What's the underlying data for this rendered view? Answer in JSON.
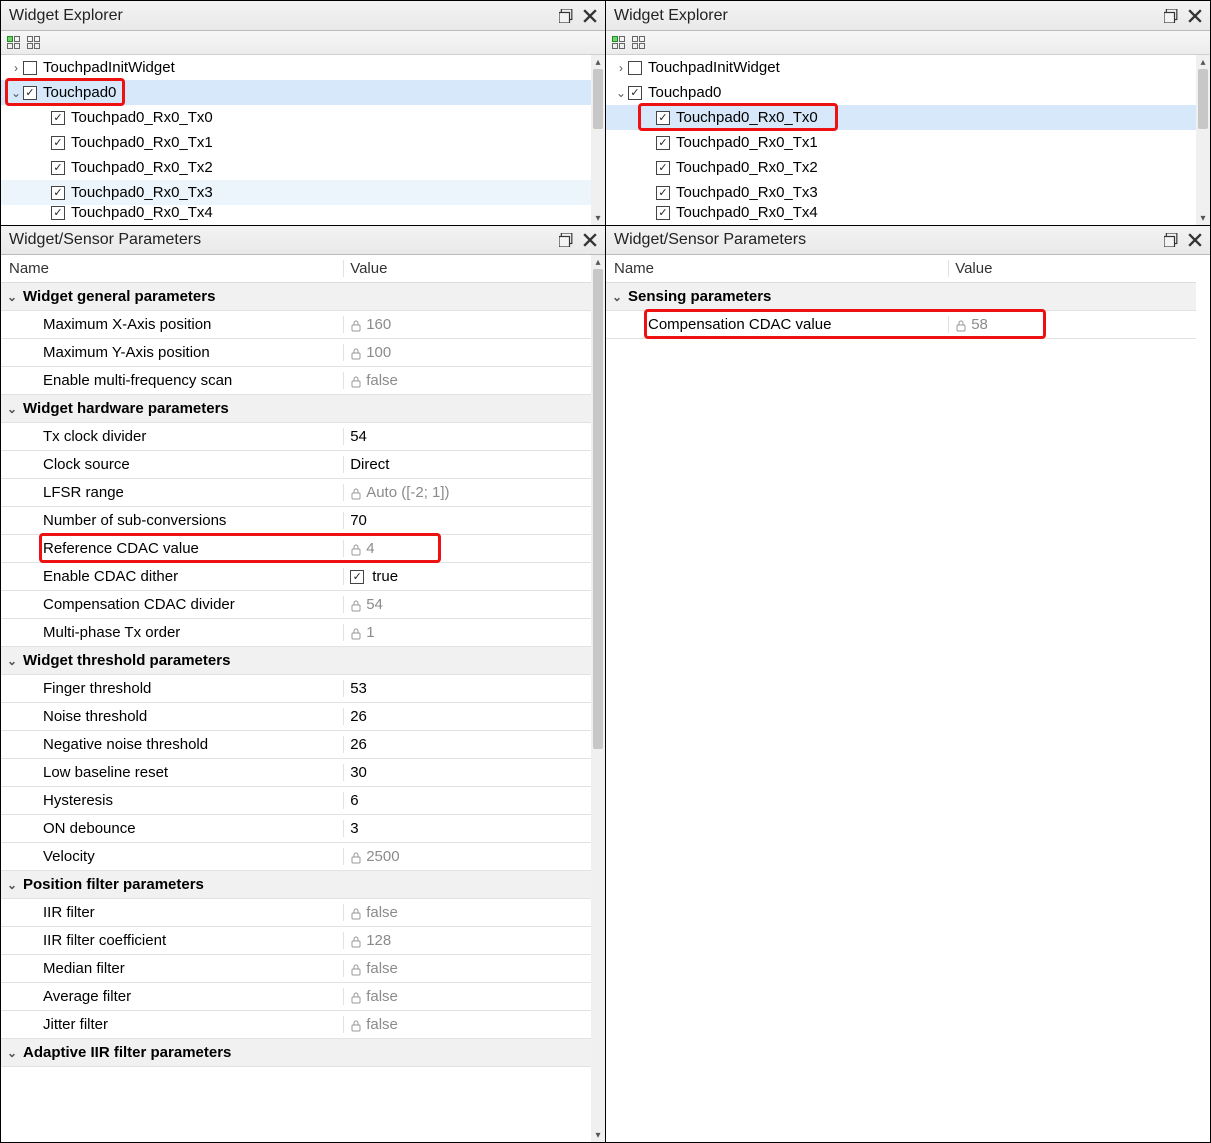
{
  "left": {
    "explorer": {
      "title": "Widget Explorer",
      "items": [
        {
          "level": 0,
          "expanded": false,
          "checked": false,
          "label": "TouchpadInitWidget",
          "selected": false
        },
        {
          "level": 0,
          "expanded": true,
          "checked": true,
          "label": "Touchpad0",
          "selected": true,
          "highlight": true
        },
        {
          "level": 1,
          "checked": true,
          "label": "Touchpad0_Rx0_Tx0"
        },
        {
          "level": 1,
          "checked": true,
          "label": "Touchpad0_Rx0_Tx1"
        },
        {
          "level": 1,
          "checked": true,
          "label": "Touchpad0_Rx0_Tx2"
        },
        {
          "level": 1,
          "checked": true,
          "label": "Touchpad0_Rx0_Tx3",
          "hover": true
        }
      ]
    },
    "params": {
      "title": "Widget/Sensor Parameters",
      "name_header": "Name",
      "value_header": "Value",
      "groups": [
        {
          "label": "Widget general parameters",
          "rows": [
            {
              "name": "Maximum X-Axis position",
              "value": "160",
              "locked": true
            },
            {
              "name": "Maximum Y-Axis position",
              "value": "100",
              "locked": true
            },
            {
              "name": "Enable multi-frequency scan",
              "value": "false",
              "locked": true
            }
          ]
        },
        {
          "label": "Widget hardware parameters",
          "rows": [
            {
              "name": "Tx clock divider",
              "value": "54"
            },
            {
              "name": "Clock source",
              "value": "Direct"
            },
            {
              "name": "LFSR range",
              "value": "Auto ([-2; 1])",
              "locked": true
            },
            {
              "name": "Number of sub-conversions",
              "value": "70"
            },
            {
              "name": "Reference CDAC value",
              "value": "4",
              "locked": true,
              "highlight": true
            },
            {
              "name": "Enable CDAC dither",
              "value": "true",
              "checkbox": true
            },
            {
              "name": "Compensation CDAC divider",
              "value": "54",
              "locked": true
            },
            {
              "name": "Multi-phase Tx order",
              "value": "1",
              "locked": true
            }
          ]
        },
        {
          "label": "Widget threshold parameters",
          "rows": [
            {
              "name": "Finger threshold",
              "value": "53"
            },
            {
              "name": "Noise threshold",
              "value": "26"
            },
            {
              "name": "Negative noise threshold",
              "value": "26"
            },
            {
              "name": "Low baseline reset",
              "value": "30"
            },
            {
              "name": "Hysteresis",
              "value": "6"
            },
            {
              "name": "ON debounce",
              "value": "3"
            },
            {
              "name": "Velocity",
              "value": "2500",
              "locked": true
            }
          ]
        },
        {
          "label": "Position filter parameters",
          "rows": [
            {
              "name": "IIR filter",
              "value": "false",
              "locked": true
            },
            {
              "name": "IIR filter coefficient",
              "value": "128",
              "locked": true
            },
            {
              "name": "Median filter",
              "value": "false",
              "locked": true
            },
            {
              "name": "Average filter",
              "value": "false",
              "locked": true
            },
            {
              "name": "Jitter filter",
              "value": "false",
              "locked": true
            }
          ]
        },
        {
          "label": "Adaptive IIR filter parameters",
          "rows": []
        }
      ]
    }
  },
  "right": {
    "explorer": {
      "title": "Widget Explorer",
      "items": [
        {
          "level": 0,
          "expanded": false,
          "checked": false,
          "label": "TouchpadInitWidget"
        },
        {
          "level": 0,
          "expanded": true,
          "checked": true,
          "label": "Touchpad0"
        },
        {
          "level": 1,
          "checked": true,
          "label": "Touchpad0_Rx0_Tx0",
          "selected": true,
          "highlight": true
        },
        {
          "level": 1,
          "checked": true,
          "label": "Touchpad0_Rx0_Tx1"
        },
        {
          "level": 1,
          "checked": true,
          "label": "Touchpad0_Rx0_Tx2"
        },
        {
          "level": 1,
          "checked": true,
          "label": "Touchpad0_Rx0_Tx3"
        }
      ]
    },
    "params": {
      "title": "Widget/Sensor Parameters",
      "name_header": "Name",
      "value_header": "Value",
      "groups": [
        {
          "label": "Sensing parameters",
          "rows": [
            {
              "name": "Compensation CDAC value",
              "value": "58",
              "locked": true,
              "highlight": true
            }
          ]
        }
      ]
    }
  }
}
